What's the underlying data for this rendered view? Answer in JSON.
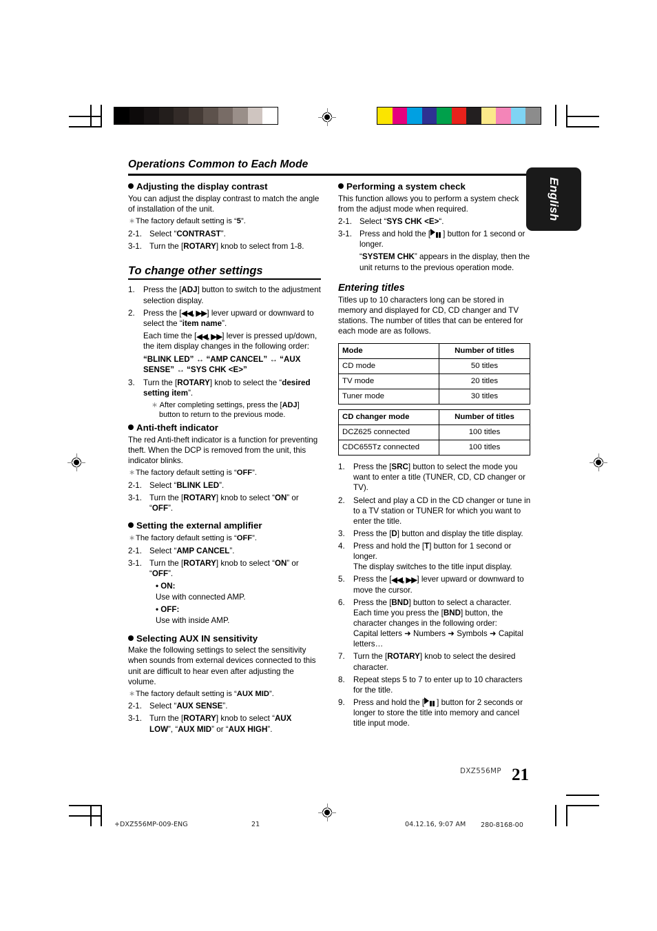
{
  "header": {
    "title": "Operations Common to Each Mode",
    "language_tab": "English"
  },
  "left_column": {
    "section_contrast": {
      "heading": "Adjusting the display contrast",
      "body": "You can adjust the display contrast to match the angle of installation of the unit.",
      "note_prefix": "The factory default setting is “",
      "note_value": "5",
      "note_suffix": "”.",
      "step1_num": "2-1.",
      "step1_pre": "Select “",
      "step1_bold": "CONTRAST",
      "step1_post": "”.",
      "step2_num": "3-1.",
      "step2_pre": "Turn the [",
      "step2_bold": "ROTARY",
      "step2_post": "] knob to select from 1-8."
    },
    "section_other_settings": {
      "heading": "To change other settings",
      "step1_num": "1.",
      "step1_pre": "Press the [",
      "step1_bold": "ADJ",
      "step1_post": "] button to switch to the adjustment selection display.",
      "step2_num": "2.",
      "step2_pre": "Press the [",
      "step2_lever": "◀◀, ▶▶",
      "step2_post": "] lever upward or downward to select the “",
      "step2_bold": "item name",
      "step2_tail": "”.",
      "step2_cont_pre": "Each time the [",
      "step2_cont_post": "] lever is pressed up/down, the item display changes in the following order:",
      "order_line1": "“BLINK LED” ↔ “AMP CANCEL”  ↔ “AUX",
      "order_line2": "SENSE” ↔ “SYS CHK <E>”",
      "step3_num": "3.",
      "step3_pre": "Turn the [",
      "step3_bold": "ROTARY",
      "step3_mid": "] knob to select the “",
      "step3_bold2": "desired setting item",
      "step3_post": "”.",
      "step3_note_pre": "After completing settings, press the [",
      "step3_note_bold": "ADJ",
      "step3_note_post": "] button to return to the previous mode."
    },
    "section_antitheft": {
      "heading": "Anti-theft indicator",
      "body": "The red Anti-theft indicator is a function for preventing theft. When the DCP is removed from the unit, this indicator blinks.",
      "note_prefix": "The factory default setting is “",
      "note_value": "OFF",
      "note_suffix": "”.",
      "step1_num": "2-1.",
      "step1_pre": "Select “",
      "step1_bold": "BLINK LED",
      "step1_post": "”.",
      "step2_num": "3-1.",
      "step2_pre": "Turn the [",
      "step2_bold": "ROTARY",
      "step2_mid": "] knob to select “",
      "step2_bold2": "ON",
      "step2_mid2": "” or",
      "step2_line2_pre": "“",
      "step2_line2_bold": "OFF",
      "step2_line2_post": "”."
    },
    "section_external_amp": {
      "heading": "Setting the external amplifier",
      "note_prefix": "The factory default setting is “",
      "note_value": "OFF",
      "note_suffix": "”.",
      "step1_num": "2-1.",
      "step1_pre": "Select “",
      "step1_bold": "AMP CANCEL",
      "step1_post": "”.",
      "step2_num": "3-1.",
      "step2_pre": "Turn the [",
      "step2_bold": "ROTARY",
      "step2_mid": "] knob to select “",
      "step2_bold2": "ON",
      "step2_mid2": "” or",
      "step2_line2_pre": "“",
      "step2_line2_bold": "OFF",
      "step2_line2_post": "”.",
      "on_label": "ON:",
      "on_body": "Use with connected AMP.",
      "off_label": "OFF:",
      "off_body": "Use with inside AMP."
    },
    "section_aux": {
      "heading": "Selecting AUX IN sensitivity",
      "body": "Make the following settings to select the sensitivity when sounds from external devices connected to this unit are difficult to hear even after adjusting the volume.",
      "note_prefix": "The factory default setting is “",
      "note_value": "AUX MID",
      "note_suffix": "”.",
      "step1_num": "2-1.",
      "step1_pre": "Select “",
      "step1_bold": "AUX SENSE",
      "step1_post": "”.",
      "step2_num": "3-1.",
      "step2_pre": "Turn the [",
      "step2_bold": "ROTARY",
      "step2_mid": "] knob to select “",
      "step2_bold2": "AUX",
      "step2_line2_b1": "LOW",
      "step2_line2_m1": "”, “",
      "step2_line2_b2": "AUX MID",
      "step2_line2_m2": "” or “",
      "step2_line2_b3": "AUX HIGH",
      "step2_line2_end": "”."
    }
  },
  "right_column": {
    "section_system_check": {
      "heading": "Performing a system check",
      "body": "This function allows you to perform a system check from the adjust mode when required.",
      "step1_num": "2-1.",
      "step1_pre": "Select “",
      "step1_bold": "SYS CHK <E>",
      "step1_post": "“.",
      "step2_num": "3-1.",
      "step2_pre": "Press and hold the [",
      "step2_icon": "play-pause-icon",
      "step2_post": "] button for 1 second or longer.",
      "step2_cont_pre": "“",
      "step2_cont_bold": "SYSTEM CHK",
      "step2_cont_post": "” appears in the display, then the unit returns to the previous operation mode."
    },
    "section_entering_titles": {
      "heading": "Entering titles",
      "body": "Titles up to 10 characters long can be stored in memory and displayed for CD, CD changer and TV stations. The number of titles that can be entered for each mode are as follows.",
      "table1": {
        "headers": [
          "Mode",
          "Number of titles"
        ],
        "rows": [
          [
            "CD mode",
            "50 titles"
          ],
          [
            "TV mode",
            "20 titles"
          ],
          [
            "Tuner mode",
            "30 titles"
          ]
        ]
      },
      "table2": {
        "headers": [
          "CD changer mode",
          "Number of titles"
        ],
        "rows": [
          [
            "DCZ625 connected",
            "100 titles"
          ],
          [
            "CDC655Tz connected",
            "100 titles"
          ]
        ]
      },
      "steps": [
        {
          "num": "1.",
          "pre": "Press the [",
          "bold": "SRC",
          "post": "] button to select the mode you want to enter a title (TUNER, CD, CD changer or TV)."
        },
        {
          "num": "2.",
          "pre": "",
          "bold": "",
          "post": "Select and play a CD in the CD changer or tune in to a TV station or TUNER for which you want to enter the title."
        },
        {
          "num": "3.",
          "pre": "Press the [",
          "bold": "D",
          "post": "] button and display the title display."
        },
        {
          "num": "4.",
          "pre": "Press and hold the [",
          "bold": "T",
          "post": "] button for 1 second or longer.",
          "cont": "The display switches to the title input display."
        },
        {
          "num": "5.",
          "pre": "Press the [",
          "lever": "◀◀, ▶▶",
          "post": "] lever upward or downward to move the cursor."
        },
        {
          "num": "6.",
          "pre": "Press the [",
          "bold": "BND",
          "mid": "] button to select a character. Each time you press the [",
          "bold2": "BND",
          "post": "] button, the character changes in the following order:",
          "cont": "Capital letters ➜ Numbers ➜ Symbols ➜ Capital letters…"
        },
        {
          "num": "7.",
          "pre": "Turn the [",
          "bold": "ROTARY",
          "post": "] knob to select the desired character."
        },
        {
          "num": "8.",
          "pre": "",
          "bold": "",
          "post": "Repeat steps 5 to 7 to enter up to 10 characters for the title."
        },
        {
          "num": "9.",
          "pre": "Press and hold the [",
          "icon": "play-pause-icon",
          "post": "] button for 2 seconds or longer to store the title into memory and cancel title input mode."
        }
      ]
    }
  },
  "footer": {
    "model": "DXZ556MP",
    "page_number": "21",
    "print_file": "+DXZ556MP-009-ENG",
    "print_page": "21",
    "print_date": "04.12.16, 9:07 AM",
    "print_code": "280-8168-00"
  },
  "print_marks": {
    "gray_wedge": [
      "#000000",
      "#0d0a0a",
      "#171313",
      "#231e1c",
      "#332b28",
      "#453b36",
      "#5d524c",
      "#786c66",
      "#9a8f89",
      "#cfc5c0",
      "#ffffff"
    ],
    "color_wedge": [
      "#fbe400",
      "#e6007e",
      "#00a0e2",
      "#2e3192",
      "#00a04b",
      "#e8221c",
      "#231f20",
      "#fbe98a",
      "#f485b8",
      "#7fd4f4",
      "#8c8c8c"
    ],
    "registration_icon": "registration-target-icon"
  }
}
